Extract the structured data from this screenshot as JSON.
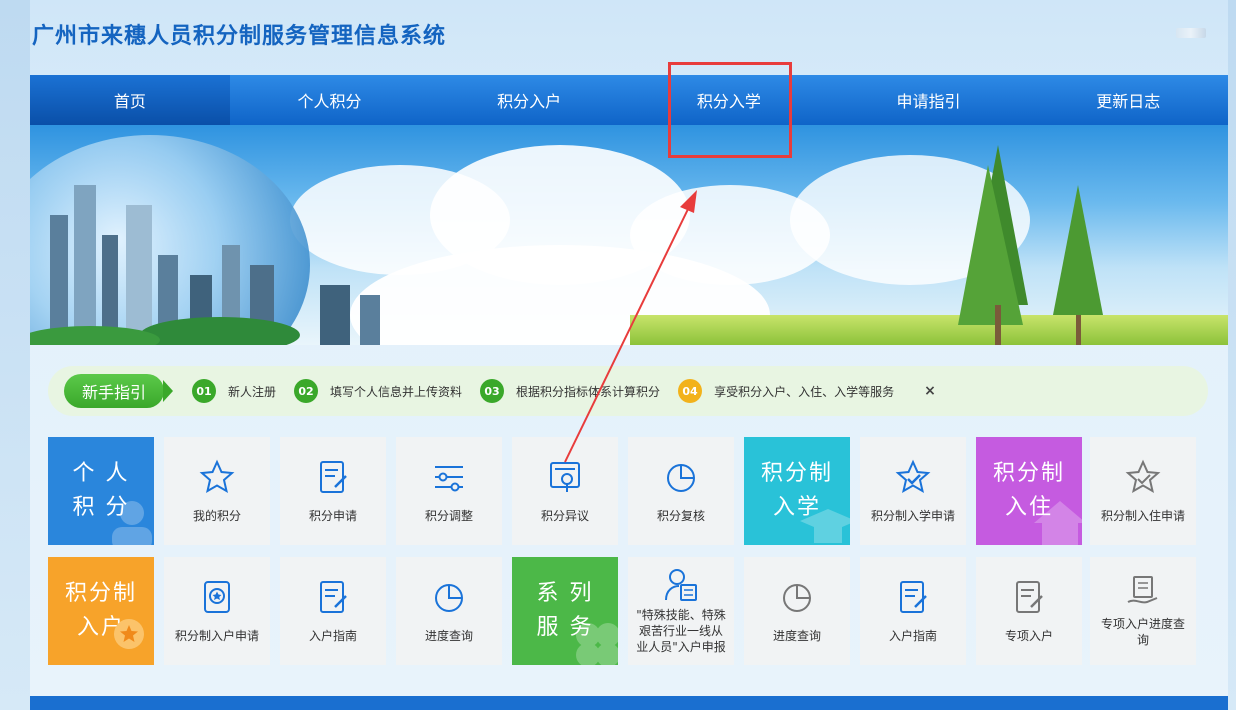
{
  "site": {
    "title": "广州市来穗人员积分制服务管理信息系统"
  },
  "nav": {
    "items": [
      {
        "label": "首页"
      },
      {
        "label": "个人积分"
      },
      {
        "label": "积分入户"
      },
      {
        "label": "积分入学"
      },
      {
        "label": "申请指引"
      },
      {
        "label": "更新日志"
      }
    ],
    "active_index": 0,
    "highlighted_index": 3
  },
  "guide": {
    "badge": "新手指引",
    "steps": [
      {
        "num": "01",
        "text": "新人注册"
      },
      {
        "num": "02",
        "text": "填写个人信息并上传资料"
      },
      {
        "num": "03",
        "text": "根据积分指标体系计算积分"
      },
      {
        "num": "04",
        "text": "享受积分入户、入住、入学等服务"
      }
    ],
    "close": "×"
  },
  "tiles_row1": [
    {
      "label": "个 人\n积 分",
      "type": "big",
      "color": "#2a86dc"
    },
    {
      "label": "我的积分",
      "icon": "star-icon"
    },
    {
      "label": "积分申请",
      "icon": "edit-doc-icon"
    },
    {
      "label": "积分调整",
      "icon": "sliders-icon"
    },
    {
      "label": "积分异议",
      "icon": "review-doc-icon"
    },
    {
      "label": "积分复核",
      "icon": "pie-chart-icon"
    },
    {
      "label": "积分制\n入学",
      "type": "big",
      "color": "#29c2d8"
    },
    {
      "label": "积分制入学申请",
      "icon": "star-check-icon"
    },
    {
      "label": "积分制\n入住",
      "type": "big",
      "color": "#c55be0"
    },
    {
      "label": "积分制入住申请",
      "icon": "star-check-outline-icon"
    }
  ],
  "tiles_row2": [
    {
      "label": "积分制\n入户",
      "type": "big",
      "color": "#f7a32a"
    },
    {
      "label": "积分制入户申请",
      "icon": "badge-icon"
    },
    {
      "label": "入户指南",
      "icon": "edit-doc-icon"
    },
    {
      "label": "进度查询",
      "icon": "pie-chart-icon"
    },
    {
      "label": "系 列\n服 务",
      "type": "big",
      "color": "#4cb848"
    },
    {
      "label": "\"特殊技能、特殊\n艰苦行业一线从\n业人员\"入户申报",
      "icon": "user-doc-icon"
    },
    {
      "label": "进度查询",
      "icon": "pie-chart-gray-icon"
    },
    {
      "label": "入户指南",
      "icon": "edit-doc-icon"
    },
    {
      "label": "专项入户",
      "icon": "edit-doc-gray-icon"
    },
    {
      "label": "专项入户进度查\n询",
      "icon": "hand-doc-icon"
    }
  ],
  "colors": {
    "nav_blue": "#0f64c8",
    "guide_green": "#3aa82a",
    "highlight_red": "#e83c3c",
    "icon_blue": "#1a73d9"
  }
}
